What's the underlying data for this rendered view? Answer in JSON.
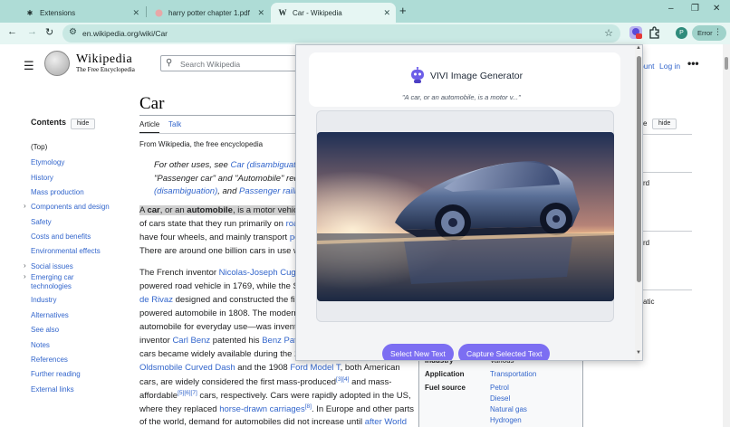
{
  "browser": {
    "tabs": [
      {
        "title": "Extensions",
        "icon": "puzzle-icon"
      },
      {
        "title": "harry potter chapter 1.pdf",
        "icon": "pdf-icon"
      },
      {
        "title": "Car - Wikipedia",
        "icon": "wikipedia-w-icon"
      }
    ],
    "new_tab_symbol": "+",
    "url": "en.wikipedia.org/wiki/Car",
    "profile_initial": "P",
    "error_label": "Error",
    "window_controls": [
      "–",
      "❐",
      "✕"
    ]
  },
  "wiki": {
    "wordmark": "Wikipedia",
    "tagline": "The Free Encyclopedia",
    "search_placeholder": "Search Wikipedia",
    "account_link": "ount",
    "login_link": "Log in",
    "more_symbol": "•••",
    "toc_title": "Contents",
    "hide_label": "hide",
    "toc_items": [
      {
        "label": "(Top)",
        "expandable": false
      },
      {
        "label": "Etymology",
        "expandable": false
      },
      {
        "label": "History",
        "expandable": false
      },
      {
        "label": "Mass production",
        "expandable": false
      },
      {
        "label": "Components and design",
        "expandable": true
      },
      {
        "label": "Safety",
        "expandable": false
      },
      {
        "label": "Costs and benefits",
        "expandable": false
      },
      {
        "label": "Environmental effects",
        "expandable": false
      },
      {
        "label": "Social issues",
        "expandable": true
      },
      {
        "label": "Emerging car technologies",
        "expandable": true
      },
      {
        "label": "Industry",
        "expandable": false
      },
      {
        "label": "Alternatives",
        "expandable": false
      },
      {
        "label": "See also",
        "expandable": false
      },
      {
        "label": "Notes",
        "expandable": false
      },
      {
        "label": "References",
        "expandable": false
      },
      {
        "label": "Further reading",
        "expandable": false
      },
      {
        "label": "External links",
        "expandable": false
      }
    ],
    "title": "Car",
    "tab_article": "Article",
    "tab_talk": "Talk",
    "from_wikipedia": "From Wikipedia, the free encyclopedia",
    "hatnote": {
      "l1_pre": "For other uses, see ",
      "l1_link": "Car (disambiguati",
      "l2": "\"Passenger car\" and \"Automobile\" red",
      "l3_link1": "(disambiguation)",
      "l3_mid": ", and ",
      "l3_link2": "Passenger railro"
    },
    "lead": {
      "l1_a": "A ",
      "l1_b": "car",
      "l1_c": ", or an ",
      "l1_d": "automobile",
      "l1_e": ", is a motor vehic",
      "l2_pre": "of cars state that they run primarily on ",
      "l2_link": "roa",
      "l3_pre": "have four wheels, and mainly transport ",
      "l3_link": "pe",
      "l4": "There are around one billion cars in use w"
    },
    "history": {
      "l1_pre": "The French inventor ",
      "l1_link": "Nicolas-Joseph Cugn",
      "l2": "powered road vehicle in 1769, while the S",
      "l3_link": "de Rivaz",
      "l3_post": " designed and constructed the fir",
      "l4": "powered automobile in 1808. The modern",
      "l5": "automobile for everyday use—was invent",
      "l6_pre": "inventor ",
      "l6_link1": "Carl Benz",
      "l6_mid": " patented his ",
      "l6_link2": "Benz Pate",
      "l7": "cars became widely available during the 2",
      "l8_link1": "Oldsmobile Curved Dash",
      "l8_mid": " and the 1908 ",
      "l8_link2": "Ford Model T",
      "l8_post": ", both American",
      "l9_pre": "cars, are widely considered the first mass-produced",
      "l9_sup": "[3][4]",
      "l9_post": " and mass-",
      "l10_pre": "affordable",
      "l10_sup": "[5][6][7]",
      "l10_post": " cars, respectively. Cars were rapidly adopted in the US,",
      "l11_pre": "where they replaced ",
      "l11_link": "horse-drawn carriages",
      "l11_post": ". In Europe and other parts",
      "l11_sup": "[8]",
      "l12_pre": "of the world, demand for automobiles did not increase until ",
      "l12_link": "after World"
    },
    "infobox": {
      "industry_key": "Industry",
      "industry_val": "Various",
      "application_key": "Application",
      "application_val": "Transportation",
      "fuel_key": "Fuel source",
      "fuel_vals": [
        "Petrol",
        "Diesel",
        "Natural gas",
        "Hydrogen"
      ]
    },
    "right_fragments": [
      "e",
      "rd",
      "rd",
      "atic"
    ]
  },
  "popup": {
    "title": "VIVI Image Generator",
    "quote": "\"A car, or an automobile, is a motor v...\"",
    "select_btn": "Select New Text",
    "capture_btn": "Capture Selected Text"
  }
}
